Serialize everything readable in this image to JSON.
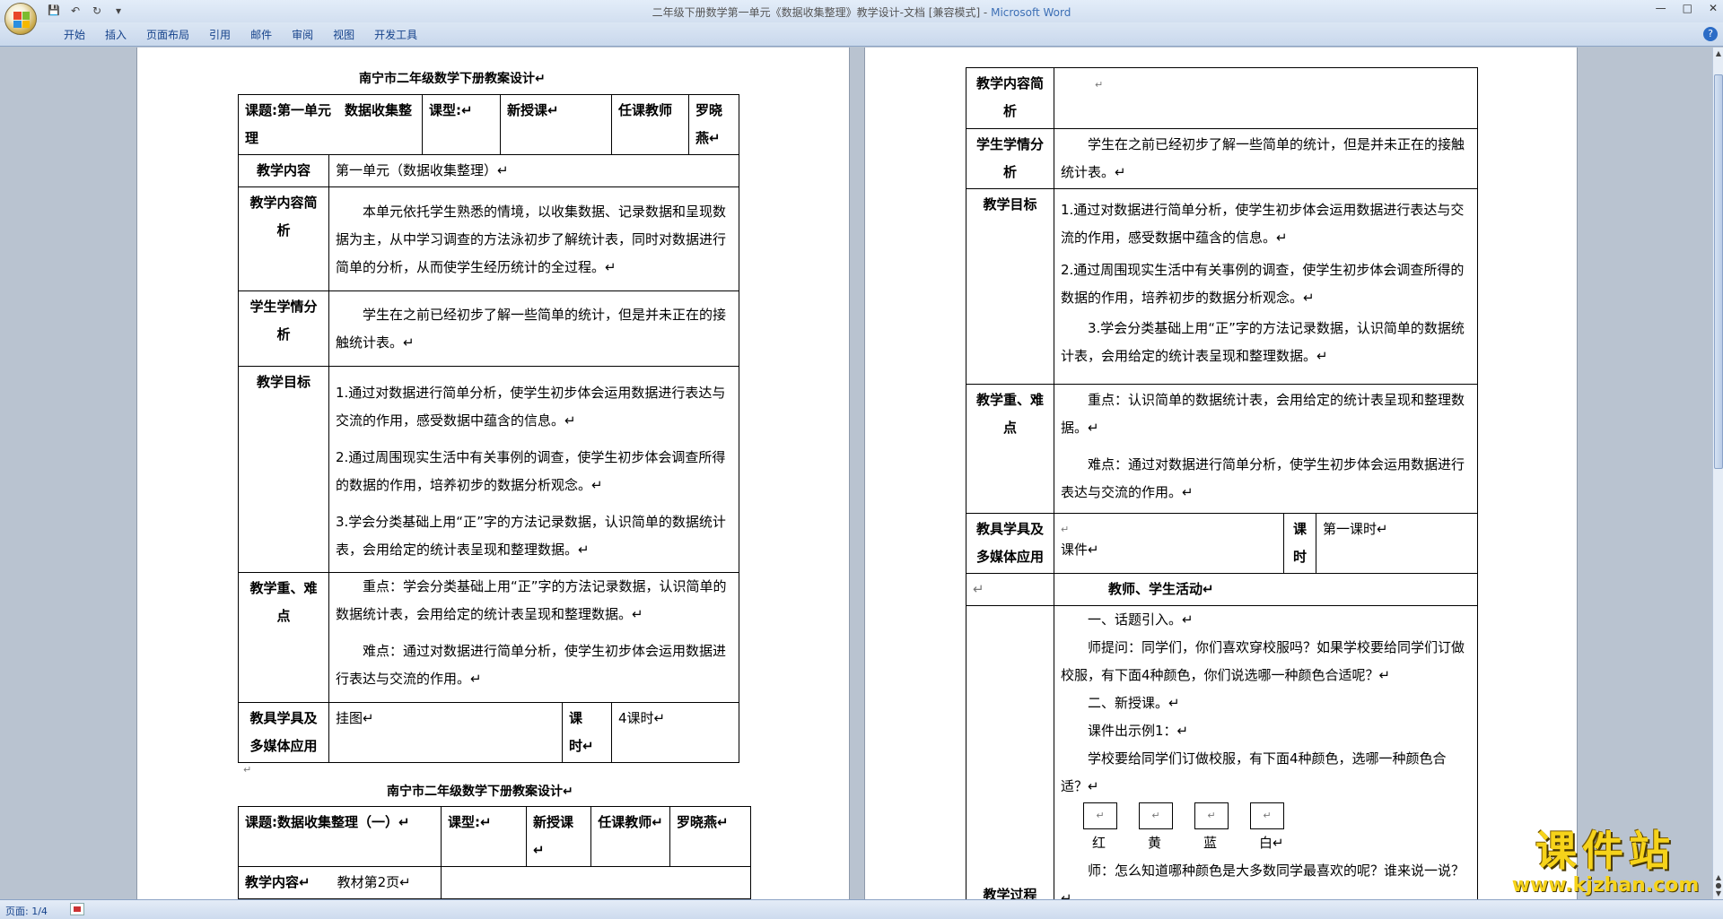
{
  "window": {
    "title": "二年级下册数学第一单元《数据收集整理》教学设计-文档 [兼容模式] - ",
    "app": "Microsoft Word",
    "min": "—",
    "max": "□",
    "close": "✕"
  },
  "ribbon": {
    "tabs": [
      "开始",
      "插入",
      "页面布局",
      "引用",
      "邮件",
      "审阅",
      "视图",
      "开发工具"
    ],
    "help": "?"
  },
  "qat": {
    "save": "💾",
    "undo": "↶",
    "redo": "↻",
    "more": "▾"
  },
  "status": {
    "page": "页面: 1/4"
  },
  "para_mark": "↵",
  "left": {
    "title1": "南宁市二年级数学下册教案设计↵",
    "subject_label": "课题:第一单元　数据收集整理",
    "type_label": "课型:↵",
    "type_value": "新授课↵",
    "teacher_label": "任课教师",
    "teacher_value": "罗晓燕↵",
    "content_label": "教学内容",
    "content_value": "第一单元（数据收集整理）↵",
    "brief_label": "教学内容简析",
    "brief_text": "本单元依托学生熟悉的情境，以收集数据、记录数据和呈现数据为主，从中学习调查的方法泳初步了解统计表，同时对数据进行简单的分析，从而使学生经历统计的全过程。↵",
    "analysis_label": "学生学情分析",
    "analysis_text": "学生在之前已经初步了解一些简单的统计，但是并未正在的接触统计表。↵",
    "goal_label": "教学目标",
    "goals": [
      "1.通过对数据进行简单分析，使学生初步体会运用数据进行表达与交流的作用，感受数据中蕴含的信息。↵",
      "2.通过周围现实生活中有关事例的调查，使学生初步体会调查所得的数据的作用，培养初步的数据分析观念。↵",
      "3.学会分类基础上用“正”字的方法记录数据，认识简单的数据统计表，会用给定的统计表呈现和整理数据。↵"
    ],
    "key_label": "教学重、难点",
    "key_text": "重点：学会分类基础上用“正”字的方法记录数据，认识简单的数据统计表，会用给定的统计表呈现和整理数据。↵",
    "hard_text": "难点：通过对数据进行简单分析，使学生初步体会运用数据进行表达与交流的作用。↵",
    "tools_label": "教具学具及多媒体应用",
    "tools_value": "挂图↵",
    "hours_label": "课　时↵",
    "hours_value": "4课时↵",
    "title2": "南宁市二年级数学下册教案设计↵",
    "subject2_label": "课题:数据收集整理（一）↵",
    "type2_label": "课型:↵",
    "type2_value": "新授课↵",
    "teacher2_label": "任课教师↵",
    "teacher2_value": "罗晓燕↵",
    "content2_label": "教学内容↵",
    "content2_value": "教材第2页↵"
  },
  "right": {
    "brief_label": "教学内容简析",
    "analysis_label": "学生学情分析",
    "analysis_text": "学生在之前已经初步了解一些简单的统计，但是并未正在的接触统计表。↵",
    "goal_label": "教学目标",
    "goals": [
      "1.通过对数据进行简单分析，使学生初步体会运用数据进行表达与交流的作用，感受数据中蕴含的信息。↵",
      "2.通过周围现实生活中有关事例的调查，使学生初步体会调查所得的数据的作用，培养初步的数据分析观念。↵",
      "3.学会分类基础上用“正”字的方法记录数据，认识简单的数据统计表，会用给定的统计表呈现和整理数据。↵"
    ],
    "key_label": "教学重、难点",
    "key_text": "重点：认识简单的数据统计表，会用给定的统计表呈现和整理数据。↵",
    "hard_text": "难点：通过对数据进行简单分析，使学生初步体会运用数据进行表达与交流的作用。↵",
    "tools_label": "教具学具及多媒体应用",
    "tools_value": "课件↵",
    "hours_label": "课时",
    "hours_value": "第一课时↵",
    "activity_header": "教师、学生活动↵",
    "process_label": "教学过程",
    "process": [
      "一、话题引入。↵",
      "师提问：同学们，你们喜欢穿校服吗？如果学校要给同学们订做校服，有下面4种颜色，你们说选哪一种颜色合适呢？↵",
      "二、新授课。↵",
      "课件出示例1：↵",
      "学校要给同学们订做校服，有下面4种颜色，选哪一种颜色合适？↵"
    ],
    "colors": [
      "红",
      "黄",
      "蓝",
      "白↵"
    ],
    "process_end": "师：怎么知道哪种颜色是大多数同学最喜欢的呢？谁来说一说？↵"
  },
  "watermark": {
    "text": "课件站",
    "url": "www.kjzhan.com"
  }
}
